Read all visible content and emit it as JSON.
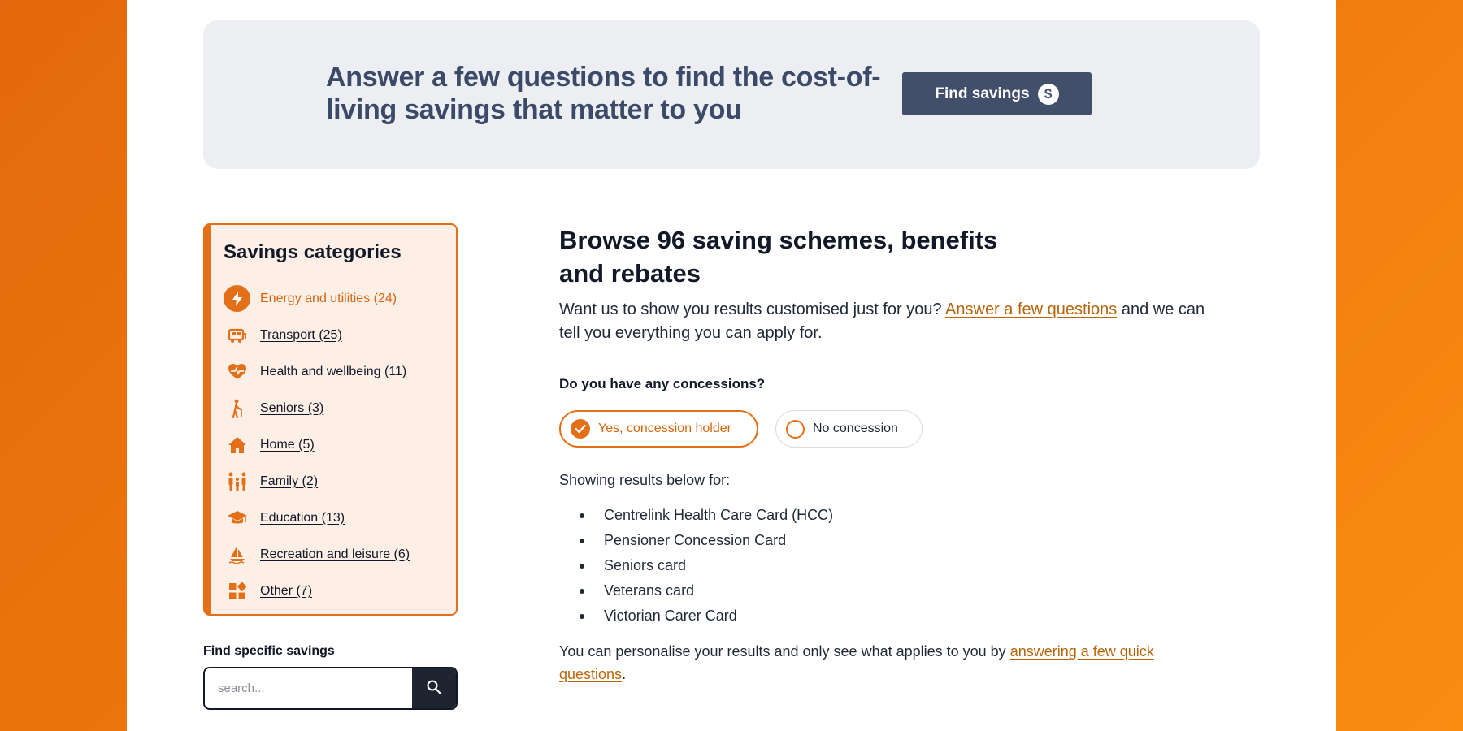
{
  "banner": {
    "heading": "Answer a few questions to find the cost-of-living savings that matter to you",
    "button_label": "Find savings",
    "button_icon": "dollar-icon"
  },
  "sidebar": {
    "title": "Savings categories",
    "items": [
      {
        "label": "Energy and utilities (24)",
        "icon": "lightning-icon",
        "active": true
      },
      {
        "label": "Transport (25)",
        "icon": "bus-icon"
      },
      {
        "label": "Health and wellbeing (11)",
        "icon": "heart-icon"
      },
      {
        "label": "Seniors (3)",
        "icon": "walking-cane-icon"
      },
      {
        "label": "Home (5)",
        "icon": "house-icon"
      },
      {
        "label": "Family (2)",
        "icon": "family-icon"
      },
      {
        "label": "Education (13)",
        "icon": "graduation-cap-icon"
      },
      {
        "label": "Recreation and leisure (6)",
        "icon": "sailboat-icon"
      },
      {
        "label": "Other (7)",
        "icon": "grid-icon"
      }
    ]
  },
  "search": {
    "label": "Find specific savings",
    "placeholder": "search...",
    "button_icon": "search-icon"
  },
  "main": {
    "heading": "Browse 96 saving schemes, benefits and rebates",
    "intro_before": "Want us to show you results customised just for you? ",
    "intro_link": "Answer a few questions",
    "intro_after": " and we can tell you everything you can apply for.",
    "question": "Do you have any concessions?",
    "option_yes": "Yes, concession holder",
    "option_no": "No concession",
    "showing": "Showing results below for:",
    "results": [
      "Centrelink Health Care Card (HCC)",
      "Pensioner Concession Card",
      "Seniors card",
      "Veterans card",
      "Victorian Carer Card"
    ],
    "personalise_before": "You can personalise your results and only see what applies to you by ",
    "personalise_link": "answering a few quick questions",
    "personalise_after": "."
  },
  "colors": {
    "accent": "#e37018",
    "banner_bg": "#eceef1",
    "button_bg": "#414f6a",
    "heading_blue": "#3a4a68",
    "sidebar_bg": "#fdefe6",
    "link": "#b8650c"
  }
}
